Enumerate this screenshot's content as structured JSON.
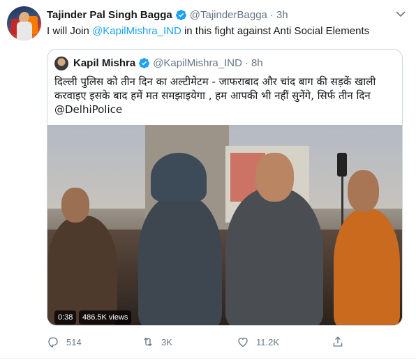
{
  "tweet": {
    "author_name": "Tajinder Pal Singh Bagga",
    "author_handle": "@TajinderBagga",
    "separator": "·",
    "time": "3h",
    "text_prefix": "I will Join ",
    "text_mention": "@KapilMishra_IND",
    "text_suffix": " in this fight against Anti Social Elements"
  },
  "quoted": {
    "author_name": "Kapil Mishra",
    "author_handle": "@KapilMishra_IND",
    "separator": "·",
    "time": "8h",
    "text_line1": "दिल्ली पुलिस को तीन दिन का अल्टीमेटम - जाफराबाद और चांद बाग की सड़कें खाली",
    "text_line2": "करवाइए इसके बाद हमें मत समझाइयेगा , हम आपकी भी नहीं सुनेंगे, सिर्फ तीन दिन",
    "text_mention": "@DelhiPolice",
    "video": {
      "duration": "0:38",
      "views": "486.5K views"
    }
  },
  "actions": {
    "reply_count": "514",
    "retweet_count": "3K",
    "like_count": "11.2K"
  },
  "colors": {
    "accent": "#1da1f2",
    "muted": "#657786",
    "border": "#ccd6dd"
  },
  "icons": [
    "verified-badge-icon",
    "caret-down-icon",
    "reply-icon",
    "retweet-icon",
    "like-icon",
    "share-icon"
  ]
}
